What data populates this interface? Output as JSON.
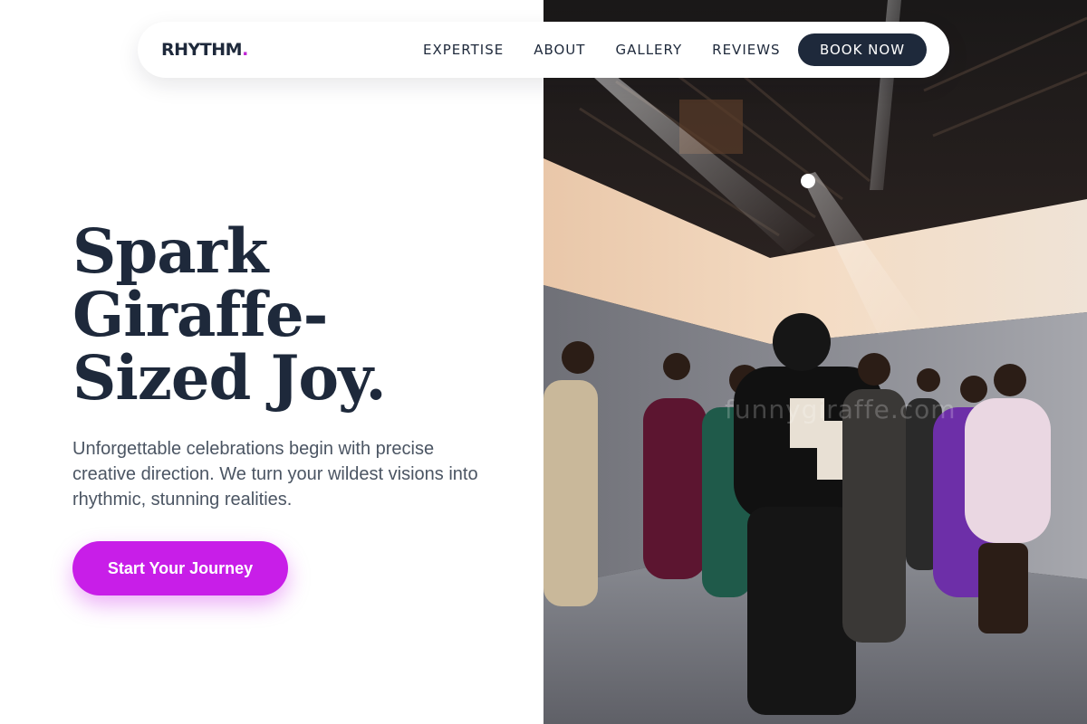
{
  "brand": {
    "name": "RHYTHM",
    "dot": ".",
    "accent": "#c026d3"
  },
  "nav": {
    "links": [
      "EXPERTISE",
      "ABOUT",
      "GALLERY",
      "REVIEWS"
    ],
    "cta_label": "BOOK NOW"
  },
  "hero": {
    "title_lines": [
      "Spark",
      "Giraffe-",
      "Sized Joy."
    ],
    "subtitle": "Unforgettable celebrations begin with precise creative direction. We turn your wildest visions into rhythmic, stunning realities.",
    "cta_label": "Start Your Journey",
    "cta_color": "#c81ee8"
  },
  "photo": {
    "watermark": "funnygiraffe.com",
    "description_icon": "event-photo"
  },
  "colors": {
    "ink": "#1e293b",
    "muted": "#4b5563"
  }
}
